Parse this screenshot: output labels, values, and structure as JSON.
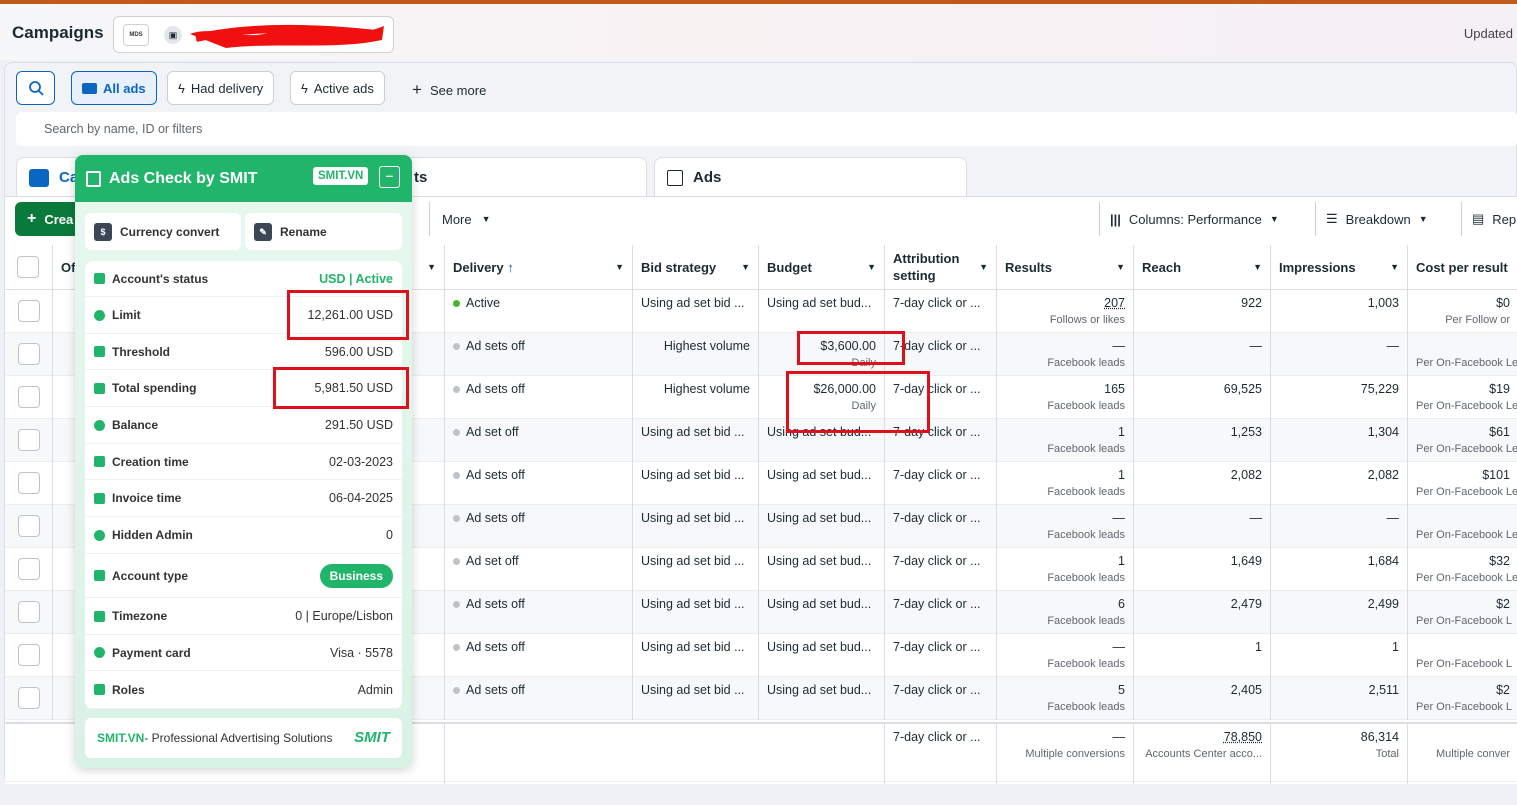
{
  "header": {
    "title": "Campaigns",
    "account_logo": "MDS",
    "updated": "Updated"
  },
  "toolbar": {
    "all_ads": "All ads",
    "had_delivery": "Had delivery",
    "active_ads": "Active ads",
    "see_more": "See more"
  },
  "search": {
    "placeholder": "Search by name, ID or filters"
  },
  "tabs": {
    "campaigns": "Ca",
    "ad_sets": "ts",
    "ads": "Ads"
  },
  "actions": {
    "create": "Crea",
    "more": "More",
    "columns": "Columns: Performance",
    "breakdown": "Breakdown",
    "reports": "Rep"
  },
  "columns": {
    "of": "Of",
    "delivery": "Delivery",
    "bid": "Bid strategy",
    "budget": "Budget",
    "attr1": "Attribution",
    "attr2": "setting",
    "results": "Results",
    "reach": "Reach",
    "impressions": "Impressions",
    "cpr": "Cost per result"
  },
  "rows": [
    {
      "delivery": "Active",
      "on": true,
      "bid": "Using ad set bid ...",
      "budget": "Using ad set bud...",
      "budget_sub": "",
      "attr": "7-day click or ...",
      "results": "207",
      "results_sub": "Follows or likes",
      "reach": "922",
      "impr": "1,003",
      "cpr": "$0",
      "cpr_sub": "Per Follow or"
    },
    {
      "delivery": "Ad sets off",
      "on": false,
      "bid": "Highest volume",
      "budget": "$3,600.00",
      "budget_sub": "Daily",
      "attr": "7-day click or ...",
      "results": "—",
      "results_sub": "Facebook leads",
      "reach": "—",
      "impr": "—",
      "cpr": "",
      "cpr_sub": "Per On-Facebook Le"
    },
    {
      "delivery": "Ad sets off",
      "on": false,
      "bid": "Highest volume",
      "budget": "$26,000.00",
      "budget_sub": "Daily",
      "attr": "7-day click or ...",
      "results": "165",
      "results_sub": "Facebook leads",
      "reach": "69,525",
      "impr": "75,229",
      "cpr": "$19",
      "cpr_sub": "Per On-Facebook Le"
    },
    {
      "delivery": "Ad set off",
      "on": false,
      "bid": "Using ad set bid ...",
      "budget": "Using ad set bud...",
      "budget_sub": "",
      "attr": "7-day click or ...",
      "results": "1",
      "results_sub": "Facebook leads",
      "reach": "1,253",
      "impr": "1,304",
      "cpr": "$61",
      "cpr_sub": "Per On-Facebook Le"
    },
    {
      "delivery": "Ad sets off",
      "on": false,
      "bid": "Using ad set bid ...",
      "budget": "Using ad set bud...",
      "budget_sub": "",
      "attr": "7-day click or ...",
      "results": "1",
      "results_sub": "Facebook leads",
      "reach": "2,082",
      "impr": "2,082",
      "cpr": "$101",
      "cpr_sub": "Per On-Facebook Le"
    },
    {
      "delivery": "Ad sets off",
      "on": false,
      "bid": "Using ad set bid ...",
      "budget": "Using ad set bud...",
      "budget_sub": "",
      "attr": "7-day click or ...",
      "results": "—",
      "results_sub": "Facebook leads",
      "reach": "—",
      "impr": "—",
      "cpr": "",
      "cpr_sub": "Per On-Facebook Le"
    },
    {
      "delivery": "Ad set off",
      "on": false,
      "bid": "Using ad set bid ...",
      "budget": "Using ad set bud...",
      "budget_sub": "",
      "attr": "7-day click or ...",
      "results": "1",
      "results_sub": "Facebook leads",
      "reach": "1,649",
      "impr": "1,684",
      "cpr": "$32",
      "cpr_sub": "Per On-Facebook Le"
    },
    {
      "delivery": "Ad sets off",
      "on": false,
      "bid": "Using ad set bid ...",
      "budget": "Using ad set bud...",
      "budget_sub": "",
      "attr": "7-day click or ...",
      "results": "6",
      "results_sub": "Facebook leads",
      "reach": "2,479",
      "impr": "2,499",
      "cpr": "$2",
      "cpr_sub": "Per On-Facebook L"
    },
    {
      "delivery": "Ad sets off",
      "on": false,
      "bid": "Using ad set bid ...",
      "budget": "Using ad set bud...",
      "budget_sub": "",
      "attr": "7-day click or ...",
      "results": "—",
      "results_sub": "Facebook leads",
      "reach": "1",
      "impr": "1",
      "cpr": "",
      "cpr_sub": "Per On-Facebook L"
    },
    {
      "delivery": "Ad sets off",
      "on": false,
      "bid": "Using ad set bid ...",
      "budget": "Using ad set bud...",
      "budget_sub": "",
      "attr": "7-day click or ...",
      "results": "5",
      "results_sub": "Facebook leads",
      "reach": "2,405",
      "impr": "2,511",
      "cpr": "$2",
      "cpr_sub": "Per On-Facebook L"
    }
  ],
  "totals": {
    "attr": "7-day click or ...",
    "results": "—",
    "results_sub": "Multiple conversions",
    "reach": "78,850",
    "reach_sub": "Accounts Center acco...",
    "impr": "86,314",
    "impr_sub": "Total",
    "cpr_sub": "Multiple conver"
  },
  "ext": {
    "title": "Ads Check by SMIT",
    "tag": "SMIT.VN",
    "minimize": "–",
    "currency": "Currency convert",
    "rename": "Rename",
    "items": [
      {
        "label": "Account's status",
        "value": "USD | Active",
        "kind": "green"
      },
      {
        "label": "Limit",
        "value": "12,261.00 USD"
      },
      {
        "label": "Threshold",
        "value": "596.00 USD"
      },
      {
        "label": "Total spending",
        "value": "5,981.50 USD"
      },
      {
        "label": "Balance",
        "value": "291.50 USD"
      },
      {
        "label": "Creation time",
        "value": "02-03-2023"
      },
      {
        "label": "Invoice time",
        "value": "06-04-2025"
      },
      {
        "label": "Hidden Admin",
        "value": "0"
      },
      {
        "label": "Account type",
        "value": "Business",
        "kind": "pill"
      },
      {
        "label": "Timezone",
        "value": "0 | Europe/Lisbon"
      },
      {
        "label": "Payment card",
        "value": "Visa · 5578"
      },
      {
        "label": "Roles",
        "value": "Admin"
      }
    ],
    "footer_brand": "SMIT.VN",
    "footer_text": " - Professional Advertising Solutions",
    "footer_logo": "SMIT"
  },
  "colors": {
    "accent": "#0a66c2",
    "create": "#0a7a3c",
    "ext": "#21b56b",
    "highlight": "#e0101a"
  }
}
